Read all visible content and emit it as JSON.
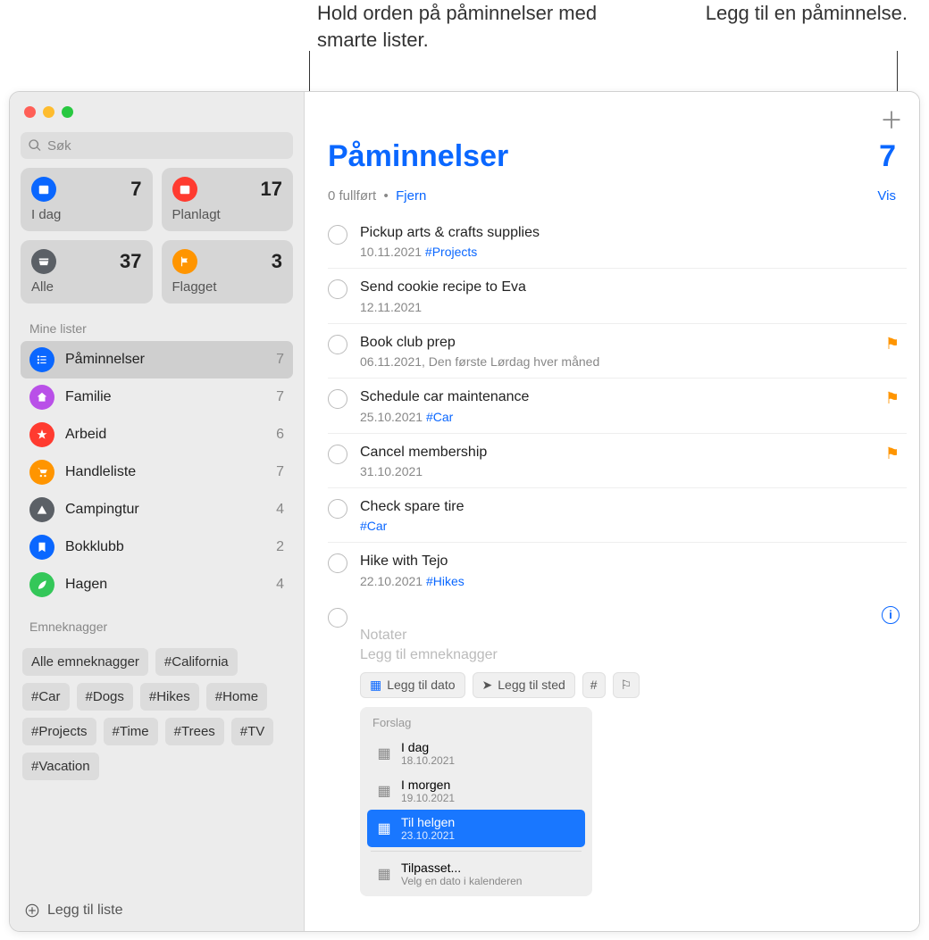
{
  "callouts": {
    "smart_lists": "Hold orden på påminnelser med smarte lister.",
    "add_reminder": "Legg til en påminnelse."
  },
  "search": {
    "placeholder": "Søk"
  },
  "smart_cards": [
    {
      "id": "today",
      "label": "I dag",
      "count": "7",
      "color": "#0a67ff"
    },
    {
      "id": "scheduled",
      "label": "Planlagt",
      "count": "17",
      "color": "#ff3b30"
    },
    {
      "id": "all",
      "label": "Alle",
      "count": "37",
      "color": "#5b6066"
    },
    {
      "id": "flagged",
      "label": "Flagget",
      "count": "3",
      "color": "#ff9500"
    }
  ],
  "sections": {
    "my_lists": "Mine lister",
    "tags": "Emneknagger"
  },
  "lists": [
    {
      "name": "Påminnelser",
      "count": "7",
      "color": "#0a67ff",
      "selected": true,
      "icon": "list"
    },
    {
      "name": "Familie",
      "count": "7",
      "color": "#b950e8",
      "icon": "home"
    },
    {
      "name": "Arbeid",
      "count": "6",
      "color": "#ff3b30",
      "icon": "star"
    },
    {
      "name": "Handleliste",
      "count": "7",
      "color": "#ff9500",
      "icon": "cart"
    },
    {
      "name": "Campingtur",
      "count": "4",
      "color": "#5b6066",
      "icon": "tent"
    },
    {
      "name": "Bokklubb",
      "count": "2",
      "color": "#0a67ff",
      "icon": "bookmark"
    },
    {
      "name": "Hagen",
      "count": "4",
      "color": "#34c759",
      "icon": "leaf"
    }
  ],
  "tags": {
    "all": "Alle emneknagger",
    "items": [
      "#California",
      "#Car",
      "#Dogs",
      "#Hikes",
      "#Home",
      "#Projects",
      "#Time",
      "#Trees",
      "#TV",
      "#Vacation"
    ]
  },
  "footer": {
    "add_list": "Legg til liste"
  },
  "main": {
    "title": "Påminnelser",
    "count": "7",
    "completed_text": "0 fullført",
    "clear": "Fjern",
    "show": "Vis",
    "reminders": [
      {
        "title": "Pickup arts & crafts supplies",
        "date": "10.11.2021",
        "tag": "#Projects",
        "flagged": false
      },
      {
        "title": "Send cookie recipe to Eva",
        "date": "12.11.2021",
        "tag": "",
        "flagged": false
      },
      {
        "title": "Book club prep",
        "date": "06.11.2021, Den første Lørdag hver måned",
        "tag": "",
        "flagged": true
      },
      {
        "title": "Schedule car maintenance",
        "date": "25.10.2021",
        "tag": "#Car",
        "flagged": true
      },
      {
        "title": "Cancel membership",
        "date": "31.10.2021",
        "tag": "",
        "flagged": true
      },
      {
        "title": "Check spare tire",
        "date": "",
        "tag": "#Car",
        "flagged": false
      },
      {
        "title": "Hike with Tejo",
        "date": "22.10.2021",
        "tag": "#Hikes",
        "flagged": false
      }
    ],
    "new_reminder": {
      "notes_placeholder": "Notater",
      "tags_placeholder": "Legg til emneknagger",
      "add_date": "Legg til dato",
      "add_location": "Legg til sted",
      "hash": "#",
      "flag": "⚑"
    },
    "suggestions": {
      "header": "Forslag",
      "items": [
        {
          "title": "I dag",
          "sub": "18.10.2021",
          "selected": false
        },
        {
          "title": "I morgen",
          "sub": "19.10.2021",
          "selected": false
        },
        {
          "title": "Til helgen",
          "sub": "23.10.2021",
          "selected": true
        }
      ],
      "custom": {
        "title": "Tilpasset...",
        "sub": "Velg en dato i kalenderen"
      }
    }
  }
}
